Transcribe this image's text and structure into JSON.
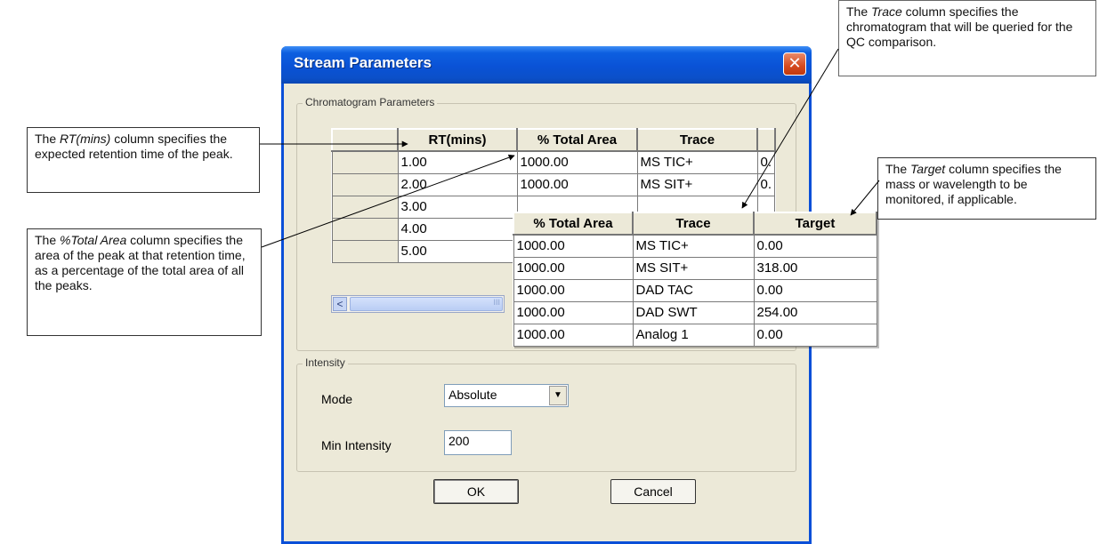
{
  "dialog": {
    "title": "Stream Parameters",
    "close_symbol": "✕",
    "chromatogram_group_label": "Chromatogram Parameters",
    "intensity_group_label": "Intensity",
    "ok_label": "OK",
    "cancel_label": "Cancel"
  },
  "main_grid": {
    "headers": [
      "RT(mins)",
      "% Total Area",
      "Trace"
    ],
    "rows": [
      {
        "rt": "1.00",
        "area": "1000.00",
        "trace": "MS TIC+",
        "extra": "0."
      },
      {
        "rt": "2.00",
        "area": "1000.00",
        "trace": "MS SIT+",
        "extra": "0."
      },
      {
        "rt": "3.00"
      },
      {
        "rt": "4.00"
      },
      {
        "rt": "5.00"
      }
    ],
    "scroll_left_symbol": "<",
    "scroll_thumb_grip": "III"
  },
  "overlay_grid": {
    "headers": [
      "% Total Area",
      "Trace",
      "Target"
    ],
    "rows": [
      {
        "area": "1000.00",
        "trace": "MS TIC+",
        "target": "0.00"
      },
      {
        "area": "1000.00",
        "trace": "MS SIT+",
        "target": "318.00"
      },
      {
        "area": "1000.00",
        "trace": "DAD TAC",
        "target": "0.00"
      },
      {
        "area": "1000.00",
        "trace": "DAD SWT",
        "target": "254.00"
      },
      {
        "area": "1000.00",
        "trace": "Analog 1",
        "target": "0.00"
      }
    ]
  },
  "intensity": {
    "mode_label": "Mode",
    "mode_value": "Absolute",
    "min_label": "Min Intensity",
    "min_value": "200"
  },
  "callouts": {
    "rt": {
      "pre": "The ",
      "em": "RT(mins)",
      "post": " column specifies the expected retention time of the peak."
    },
    "area": {
      "pre": "The ",
      "em": "%Total Area",
      "post": " column specifies the area of the peak at that retention time, as a percentage of the total area of all the peaks."
    },
    "trace": {
      "pre": "The ",
      "em": "Trace",
      "post": " column specifies the chromatogram that will be queried for the QC comparison."
    },
    "target": {
      "pre": "The ",
      "em": "Target",
      "post": " column specifies the mass or wavelength to be monitored, if applicable."
    }
  }
}
